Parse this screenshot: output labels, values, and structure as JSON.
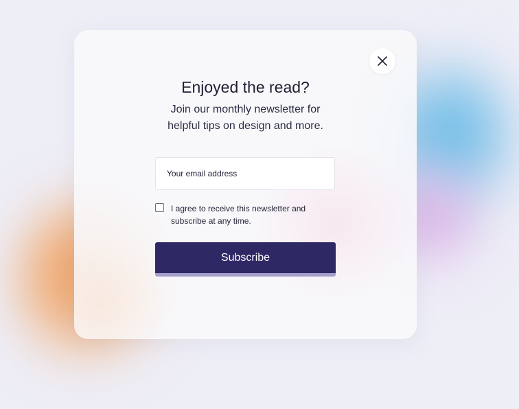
{
  "modal": {
    "title": "Enjoyed the read?",
    "subtitle_line1": "Join our monthly newsletter for",
    "subtitle_line2": "helpful tips on design and more.",
    "close_icon": "close-icon"
  },
  "form": {
    "email_placeholder": "Your email address",
    "email_value": "",
    "consent_checked": false,
    "consent_line1": "I agree to receive this newsletter and",
    "consent_line2": "subscribe at any time.",
    "submit_label": "Subscribe"
  },
  "colors": {
    "background": "#eeeef7",
    "button": "#2e2864",
    "button_underline": "#a49fcb",
    "text": "#1e1f33",
    "blob_orange": "#ec9a5a",
    "blob_blue": "#5ebbe6",
    "blob_purple": "#d3a3df"
  }
}
